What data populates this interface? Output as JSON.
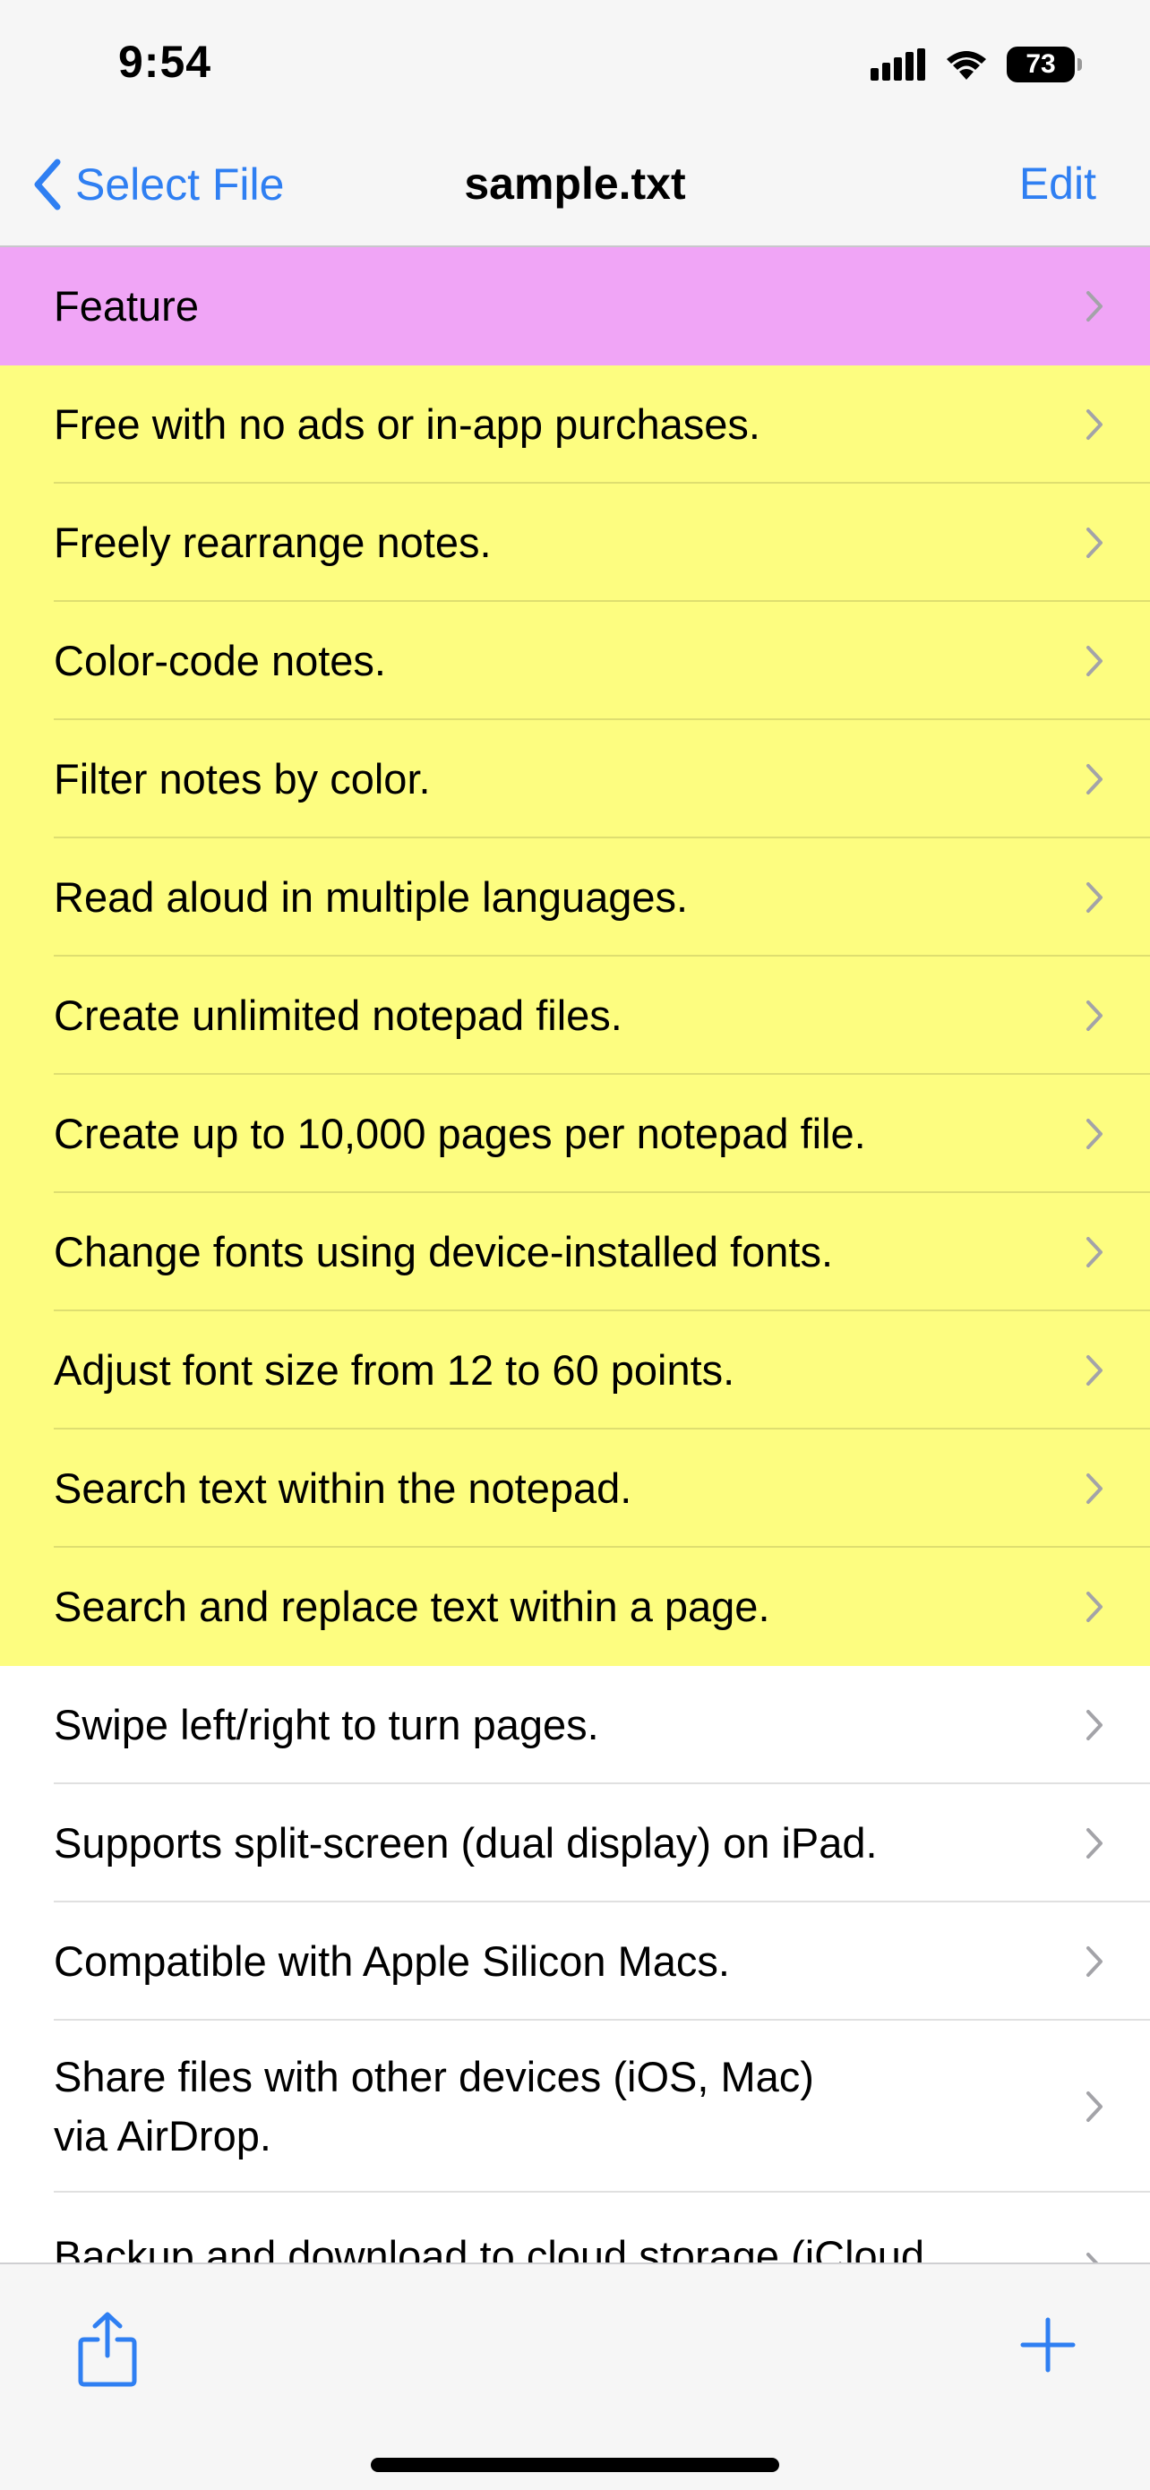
{
  "status_bar": {
    "time": "9:54",
    "battery": "73"
  },
  "nav": {
    "back_label": "Select File",
    "title": "sample.txt",
    "edit_label": "Edit"
  },
  "colors": {
    "accent": "#2f7ff2",
    "header_row": "#f0a5f6",
    "highlight_rows": "#fdfd80",
    "plain_rows": "#ffffff"
  },
  "rows": [
    {
      "label": "Feature",
      "color": "#f0a5f6"
    },
    {
      "label": "Free with no ads or in-app purchases.",
      "color": "#fdfd80"
    },
    {
      "label": "Freely rearrange notes.",
      "color": "#fdfd80"
    },
    {
      "label": "Color-code notes.",
      "color": "#fdfd80"
    },
    {
      "label": "Filter notes by color.",
      "color": "#fdfd80"
    },
    {
      "label": "Read aloud in multiple languages.",
      "color": "#fdfd80"
    },
    {
      "label": "Create unlimited notepad files.",
      "color": "#fdfd80"
    },
    {
      "label": "Create up to 10,000 pages per notepad file.",
      "color": "#fdfd80"
    },
    {
      "label": "Change fonts using device-installed fonts.",
      "color": "#fdfd80"
    },
    {
      "label": "Adjust font size from 12 to 60 points.",
      "color": "#fdfd80"
    },
    {
      "label": "Search text within the notepad.",
      "color": "#fdfd80"
    },
    {
      "label": "Search and replace text within a page.",
      "color": "#fdfd80"
    },
    {
      "label": "Swipe left/right to turn pages.",
      "color": "#ffffff"
    },
    {
      "label": "Supports split-screen (dual display) on iPad.",
      "color": "#ffffff"
    },
    {
      "label": "Compatible with Apple Silicon Macs.",
      "color": "#ffffff"
    },
    {
      "label": "Share files with other devices (iOS, Mac)\nvia AirDrop.",
      "color": "#ffffff"
    },
    {
      "label": "Backup and download to cloud storage (iCloud,",
      "color": "#ffffff"
    }
  ],
  "toolbar": {
    "share_icon": "share-icon",
    "add_icon": "plus-icon"
  }
}
